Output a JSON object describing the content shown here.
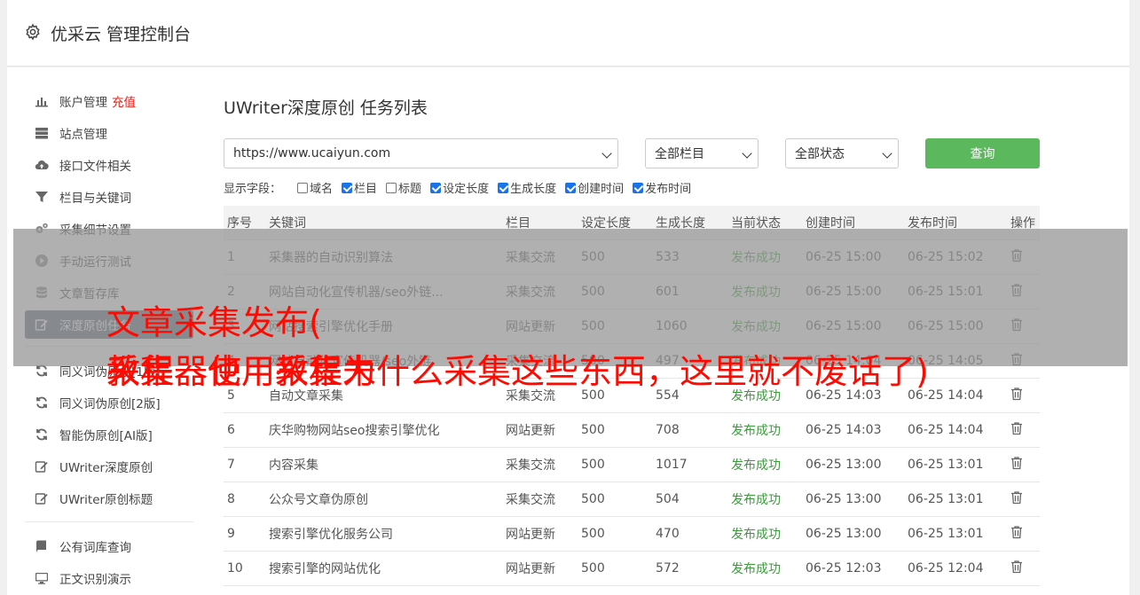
{
  "header": {
    "title": "优采云 管理控制台",
    "icon": "gear-icon"
  },
  "sidebar": {
    "group1": [
      {
        "label": "账户管理",
        "extra": "充值",
        "icon": "bar-chart-icon"
      },
      {
        "label": "站点管理",
        "icon": "server-icon"
      },
      {
        "label": "接口文件相关",
        "icon": "cloud-upload-icon"
      },
      {
        "label": "栏目与关键词",
        "icon": "filter-icon"
      },
      {
        "label": "采集细节设置",
        "icon": "gears-icon"
      },
      {
        "label": "手动运行测试",
        "icon": "play-icon"
      },
      {
        "label": "文章暂存库",
        "icon": "database-icon"
      },
      {
        "label": "深度原创任务",
        "icon": "edit-icon",
        "active": true
      }
    ],
    "group2": [
      {
        "label": "同义词伪原创[1版]",
        "icon": "refresh-icon"
      },
      {
        "label": "同义词伪原创[2版]",
        "icon": "refresh-icon"
      },
      {
        "label": "智能伪原创[AI版]",
        "icon": "refresh-icon"
      },
      {
        "label": "UWriter深度原创",
        "icon": "edit-icon"
      },
      {
        "label": "UWriter原创标题",
        "icon": "edit-icon"
      }
    ],
    "group3": [
      {
        "label": "公有词库查询",
        "icon": "book-icon"
      },
      {
        "label": "正文识别演示",
        "icon": "monitor-icon"
      }
    ]
  },
  "main": {
    "title": "UWriter深度原创 任务列表",
    "site_select": "https://www.ucaiyun.com",
    "column_select": "全部栏目",
    "status_select": "全部状态",
    "query_button": "查询",
    "fields_label": "显示字段：",
    "fields": [
      {
        "label": "域名",
        "checked": false
      },
      {
        "label": "栏目",
        "checked": true
      },
      {
        "label": "标题",
        "checked": false
      },
      {
        "label": "设定长度",
        "checked": true
      },
      {
        "label": "生成长度",
        "checked": true
      },
      {
        "label": "创建时间",
        "checked": true
      },
      {
        "label": "发布时间",
        "checked": true
      }
    ],
    "table": {
      "headers": [
        "序号",
        "关键词",
        "栏目",
        "设定长度",
        "生成长度",
        "当前状态",
        "创建时间",
        "发布时间",
        "操作"
      ],
      "rows": [
        [
          "1",
          "采集器的自动识别算法",
          "采集交流",
          "500",
          "533",
          "发布成功",
          "06-25 15:00",
          "06-25 15:02"
        ],
        [
          "2",
          "网站自动化宣传机器/seo外链...",
          "采集交流",
          "500",
          "601",
          "发布成功",
          "06-25 15:00",
          "06-25 15:01"
        ],
        [
          "3",
          "网站搜索引擎优化手册",
          "网站更新",
          "500",
          "1060",
          "发布成功",
          "06-25 15:00",
          "06-25 15:00"
        ],
        [
          "4",
          "网站自动化宣传机器/seo外链",
          "采集交流",
          "500",
          "497",
          "发布成功",
          "06-25 14:04",
          "06-25 14:05"
        ],
        [
          "5",
          "自动文章采集",
          "采集交流",
          "500",
          "554",
          "发布成功",
          "06-25 14:03",
          "06-25 14:04"
        ],
        [
          "6",
          "庆华购物网站seo搜索引擎优化",
          "网站更新",
          "500",
          "708",
          "发布成功",
          "06-25 14:03",
          "06-25 14:04"
        ],
        [
          "7",
          "内容采集",
          "采集交流",
          "500",
          "1017",
          "发布成功",
          "06-25 13:00",
          "06-25 13:01"
        ],
        [
          "8",
          "公众号文章伪原创",
          "采集交流",
          "500",
          "504",
          "发布成功",
          "06-25 13:00",
          "06-25 13:01"
        ],
        [
          "9",
          "搜索引擎优化服务公司",
          "网站更新",
          "500",
          "470",
          "发布成功",
          "06-25 13:00",
          "06-25 13:01"
        ],
        [
          "10",
          "搜索引擎的网站优化",
          "网站更新",
          "500",
          "572",
          "发布成功",
          "06-25 12:03",
          "06-25 12:04"
        ]
      ]
    }
  },
  "overlay": {
    "line1": "文章采集发布(",
    "line2a": "教程器使用教程未",
    "line2b": "采集器也用采集为什么采集这些东西，这里就不废话了)"
  },
  "colors": {
    "accent_green": "#5cb85c",
    "status_green": "#3c9a3c",
    "overlay_red": "#ff0a00",
    "active_bg": "#5a6577"
  }
}
